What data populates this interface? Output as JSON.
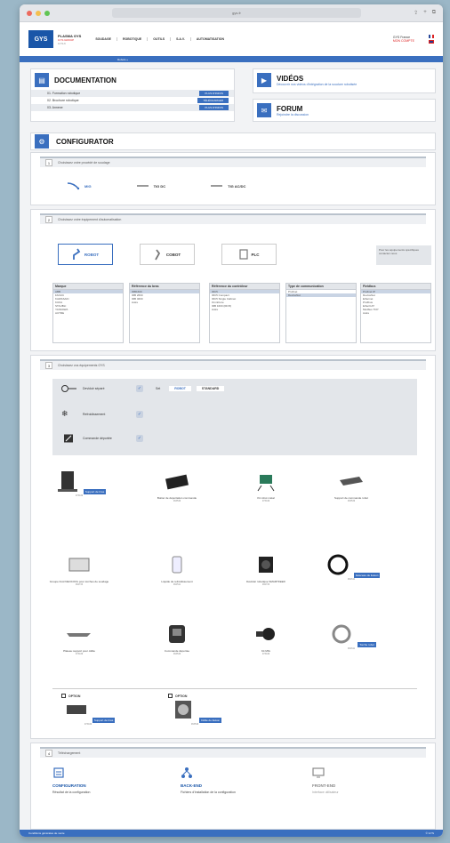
{
  "browser": {
    "url": "gys.fr"
  },
  "header": {
    "brand_line1": "PLASMA GYS",
    "brand_line2": "GYS GROUP",
    "brand_line3": "GYS.fr",
    "nav": [
      "SOUDAGE",
      "ROBOTIQUE",
      "OUTILS",
      "S.A.V.",
      "AUTOMATISATION"
    ],
    "account_line1": "GYS France",
    "account_line2": "MON COMPTE",
    "strip": "Robots »"
  },
  "documentation": {
    "title": "DOCUMENTATION",
    "rows": [
      {
        "label": "01. Formation robotique",
        "action": "PLUS D'INFOS"
      },
      {
        "label": "02. Brochure robotique",
        "action": "TÉLÉCHARGER"
      },
      {
        "label": "03. Annexe",
        "action": "PLUS D'INFOS"
      }
    ]
  },
  "videos": {
    "title": "VIDÉOS",
    "link": "Découvrir nos vidéos d'intégration de la soudure robotisée"
  },
  "forum": {
    "title": "FORUM",
    "link": "Rejoindre la discussion"
  },
  "configurator": {
    "title": "CONFIGURATOR",
    "step1": {
      "num": "1",
      "label": "Choisissez votre procédé de soudage",
      "processes": [
        "MIG",
        "TIG DC",
        "TIG AC/DC"
      ]
    },
    "step2": {
      "num": "2",
      "label": "Choisissez votre équipement d'automatisation",
      "options": [
        "ROBOT",
        "COBOT",
        "PLC"
      ],
      "note": "Pour les équipements spécifiques contactez-nous",
      "lists": [
        {
          "head": "Marque",
          "items": [
            "ABB",
            "FANUC",
            "KAWASAKI",
            "KUKA",
            "STAUBLI",
            "YASKAWA",
            "AUTRE"
          ],
          "sel": 0
        },
        {
          "head": "Référence du bras",
          "items": [
            "IRB1600",
            "IRB 2600",
            "IRB 4600",
            "Autre"
          ],
          "sel": 0
        },
        {
          "head": "Référence du contrôleur",
          "items": [
            "IRC5",
            "IRC5 Compact",
            "IRC5 Single Cabinet",
            "OmniCore",
            "IRB 1600 (IRC5)",
            "Autre"
          ],
          "sel": 0
        },
        {
          "head": "Type de communication",
          "items": [
            "Profinet",
            "DeviceNet"
          ],
          "sel": 1
        },
        {
          "head": "Fieldbus",
          "items": [
            "Profinet IP",
            "DeviceNet",
            "Ethernet",
            "Profibus",
            "EtherCAT",
            "Modbus TCP",
            "Autre"
          ],
          "sel": 0
        }
      ]
    },
    "step3": {
      "num": "3",
      "label": "Choisissez vos équipements GYS",
      "options": [
        {
          "label": "Devidoir séparé",
          "extra1": "Set",
          "extra2": "ROBOT",
          "extra3": "STANDARD"
        },
        {
          "label": "Refroidissement",
          "extra1": "",
          "extra2": "",
          "extra3": ""
        },
        {
          "label": "Commande déportée",
          "extra1": "",
          "extra2": "",
          "extra3": ""
        }
      ],
      "products": [
        {
          "name": "Support de bras",
          "ref": "073449",
          "selected": "Support de bras",
          "icon": "stand-icon"
        },
        {
          "name": "Boitier de déportation commande",
          "ref": "063549",
          "selected": "",
          "icon": "case-icon"
        },
        {
          "name": "Kit robot métal",
          "ref": "073449",
          "selected": "",
          "icon": "kit-icon"
        },
        {
          "name": "Support de commande robot",
          "ref": "063549",
          "selected": "",
          "icon": "plate-icon"
        },
        {
          "name": "Groupe froid NEOCOOL pour torches de soudage",
          "ref": "062733",
          "selected": "",
          "icon": "cooler-icon"
        },
        {
          "name": "Liquide de refroidissement",
          "ref": "062511",
          "selected": "",
          "icon": "liquid-icon"
        },
        {
          "name": "Dévidoir robotique SMARTFEED",
          "ref": "062733",
          "selected": "",
          "icon": "feeder-icon"
        },
        {
          "name": "Faisceau de liaison",
          "ref": "062611",
          "selected": "Faisceau de liaison",
          "icon": "cable-icon"
        },
        {
          "name": "Plateau support pour câble",
          "ref": "073449",
          "selected": "",
          "icon": "tray-icon"
        },
        {
          "name": "Commande déportée",
          "ref": "063549",
          "selected": "",
          "icon": "remote-icon"
        },
        {
          "name": "Kit MIG",
          "ref": "073449",
          "selected": "",
          "icon": "spool-icon"
        },
        {
          "name": "Torche robot",
          "ref": "062611",
          "selected": "Torche robot",
          "icon": "coil-icon"
        }
      ],
      "optional": [
        {
          "label": "OPTION",
          "ref": "073449",
          "selected": "Support de bras",
          "icon": "base-icon"
        },
        {
          "label": "OPTION",
          "ref": "063549",
          "selected": "Câble de liaison",
          "icon": "reel-icon"
        }
      ]
    },
    "step4": {
      "num": "4",
      "label": "Téléchargement",
      "cols": [
        {
          "title": "CONFIGURATION",
          "desc": "Résultat de la configuration",
          "icon": "doc-icon"
        },
        {
          "title": "BACK-END",
          "desc": "Fichiers d'installation de la configuration",
          "icon": "network-icon"
        },
        {
          "title": "FRONT-END",
          "desc": "Interface utilisateur",
          "icon": "screen-icon"
        }
      ]
    }
  },
  "footer": {
    "left": "Conditions générales de vente",
    "right": "© GYS"
  },
  "colors": {
    "accent": "#3a6fbf",
    "brand": "#1a56a8",
    "alert": "#d22222"
  }
}
